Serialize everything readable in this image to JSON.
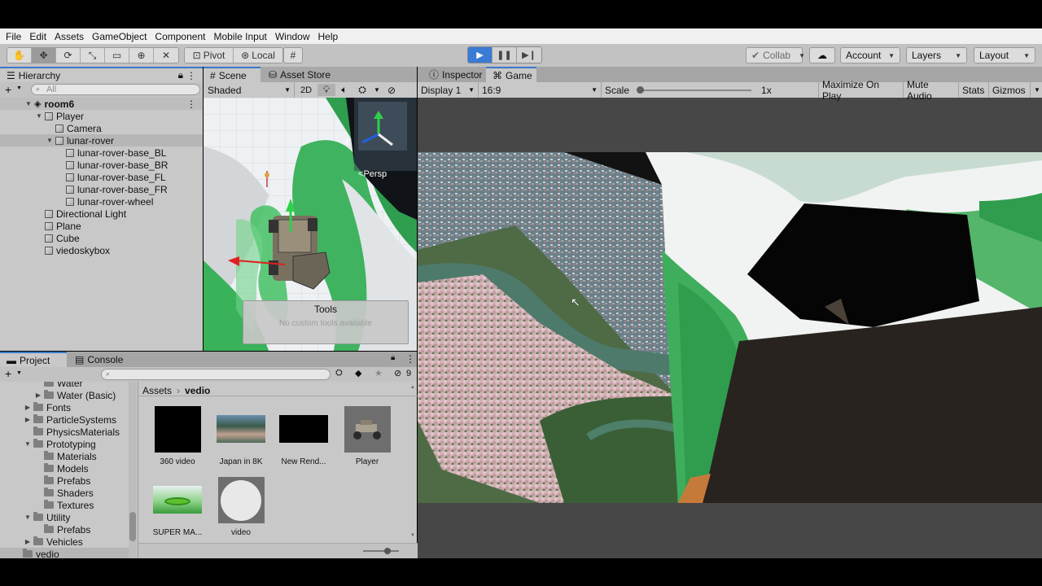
{
  "menu": [
    "File",
    "Edit",
    "Assets",
    "GameObject",
    "Component",
    "Mobile Input",
    "Window",
    "Help"
  ],
  "toolbar": {
    "pivot_label": "Pivot",
    "local_label": "Local",
    "collab_label": "Collab",
    "account_label": "Account",
    "layers_label": "Layers",
    "layout_label": "Layout"
  },
  "hierarchy": {
    "tab_label": "Hierarchy",
    "search_placeholder": "All",
    "scene_name": "room6",
    "items": [
      {
        "label": "Player",
        "depth": 1,
        "expanded": true
      },
      {
        "label": "Camera",
        "depth": 2
      },
      {
        "label": "lunar-rover",
        "depth": 2,
        "expanded": true,
        "selected": true
      },
      {
        "label": "lunar-rover-base_BL",
        "depth": 3
      },
      {
        "label": "lunar-rover-base_BR",
        "depth": 3
      },
      {
        "label": "lunar-rover-base_FL",
        "depth": 3
      },
      {
        "label": "lunar-rover-base_FR",
        "depth": 3
      },
      {
        "label": "lunar-rover-wheel",
        "depth": 3
      },
      {
        "label": "Directional Light",
        "depth": 1
      },
      {
        "label": "Plane",
        "depth": 1
      },
      {
        "label": "Cube",
        "depth": 1
      },
      {
        "label": "viedoskybox",
        "depth": 1
      }
    ]
  },
  "scene": {
    "tab_label": "Scene",
    "asset_store_label": "Asset Store",
    "shading_mode": "Shaded",
    "mode_2d": "2D",
    "persp_label": "Persp",
    "tools_overlay_title": "Tools",
    "tools_overlay_text": "No custom tools available"
  },
  "project": {
    "tab_label": "Project",
    "console_label": "Console",
    "hidden_count": "9",
    "breadcrumb_root": "Assets",
    "breadcrumb_current": "vedio",
    "tree": [
      {
        "label": "Water",
        "depth": 2,
        "partial": true
      },
      {
        "label": "Water (Basic)",
        "depth": 2,
        "collapsed": true
      },
      {
        "label": "Fonts",
        "depth": 1,
        "collapsed": true
      },
      {
        "label": "ParticleSystems",
        "depth": 1,
        "collapsed": true
      },
      {
        "label": "PhysicsMaterials",
        "depth": 1
      },
      {
        "label": "Prototyping",
        "depth": 1,
        "expanded": true
      },
      {
        "label": "Materials",
        "depth": 2
      },
      {
        "label": "Models",
        "depth": 2
      },
      {
        "label": "Prefabs",
        "depth": 2
      },
      {
        "label": "Shaders",
        "depth": 2
      },
      {
        "label": "Textures",
        "depth": 2
      },
      {
        "label": "Utility",
        "depth": 1,
        "expanded": true
      },
      {
        "label": "Prefabs",
        "depth": 2
      },
      {
        "label": "Vehicles",
        "depth": 1,
        "collapsed": true
      },
      {
        "label": "vedio",
        "depth": 0,
        "selected": true
      }
    ],
    "assets": [
      {
        "label": "360 video"
      },
      {
        "label": "Japan in 8K"
      },
      {
        "label": "New Rend..."
      },
      {
        "label": "Player"
      },
      {
        "label": "SUPER MA..."
      },
      {
        "label": "video"
      }
    ]
  },
  "game": {
    "inspector_tab": "Inspector",
    "game_tab": "Game",
    "display": "Display 1",
    "aspect": "16:9",
    "scale_label": "Scale",
    "scale_value": "1x",
    "maximize_on_play": "Maximize On Play",
    "mute_audio": "Mute Audio",
    "stats": "Stats",
    "gizmos": "Gizmos"
  },
  "colors": {
    "play_active": "#3a7bd5",
    "panel_bg": "#c8c8c8",
    "selection": "#b6b6b6"
  }
}
